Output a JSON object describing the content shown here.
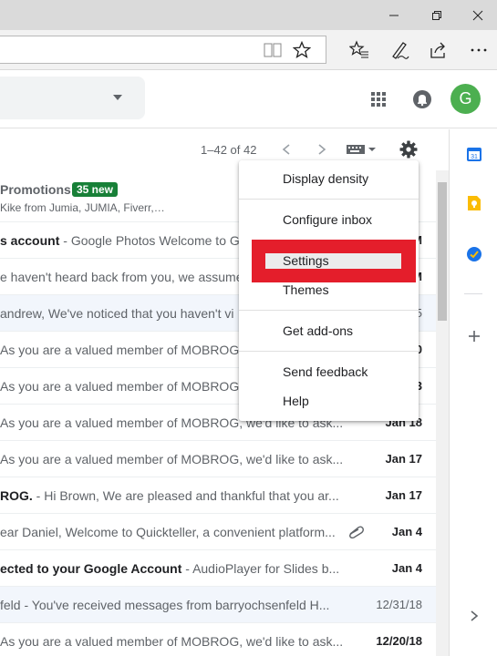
{
  "window": {
    "minimize_icon": "minimize-icon",
    "restore_icon": "restore-icon",
    "close_icon": "close-icon"
  },
  "browser": {
    "toolbar_icons": [
      "reading-view-icon",
      "favorite-star-icon",
      "favorites-hub-icon",
      "pen-icon",
      "share-icon",
      "more-icon"
    ]
  },
  "gmail": {
    "avatar_letter": "G",
    "avatar_color": "#4caf50",
    "page_range": "1–42 of 42"
  },
  "promotions": {
    "title": "Promotions",
    "badge": "35 new",
    "senders": "Kike from Jumia, JUMIA, Fiverr,…"
  },
  "messages": [
    {
      "subject": "s account",
      "snippet": "Google Photos Welcome to Go",
      "date": "",
      "read": false
    },
    {
      "subject": "",
      "snippet": "e haven't heard back from you, we assume",
      "date": "",
      "read": false
    },
    {
      "subject": "",
      "snippet": "andrew, We've noticed that you haven't vi",
      "date": "",
      "read": true
    },
    {
      "subject": "",
      "snippet": "As you are a valued member of MOBROG,",
      "date": "",
      "read": false
    },
    {
      "subject": "",
      "snippet": "As you are a valued member of MOBROG,",
      "date": "",
      "read": false
    },
    {
      "subject": "",
      "snippet": "As you are a valued member of MOBROG, we'd like to ask...",
      "date": "Jan 18",
      "read": false
    },
    {
      "subject": "",
      "snippet": "As you are a valued member of MOBROG, we'd like to ask...",
      "date": "Jan 17",
      "read": false
    },
    {
      "subject": "ROG.",
      "snippet": "Hi Brown, We are pleased and thankful that you ar...",
      "date": "Jan 17",
      "read": false
    },
    {
      "subject": "",
      "snippet": "ear Daniel, Welcome to Quickteller, a convenient platform...",
      "date": "Jan 4",
      "read": false,
      "attachment": true
    },
    {
      "subject": "ected to your Google Account",
      "snippet": "AudioPlayer for Slides b...",
      "date": "Jan 4",
      "read": false
    },
    {
      "subject": "",
      "snippet": "feld - You've received messages from barryochsenfeld H...",
      "date": "12/31/18",
      "read": true
    },
    {
      "subject": "",
      "snippet": "As you are a valued member of MOBROG, we'd like to ask...",
      "date": "12/20/18",
      "read": false
    }
  ],
  "partial_dates": [
    "M",
    "M",
    "5",
    "0",
    "3"
  ],
  "menu": {
    "items": [
      "Display density",
      "Configure inbox",
      "Settings",
      "Themes",
      "Get add-ons",
      "Send feedback",
      "Help"
    ]
  },
  "colors": {
    "highlight": "#e41e2b",
    "badge": "#188038"
  }
}
